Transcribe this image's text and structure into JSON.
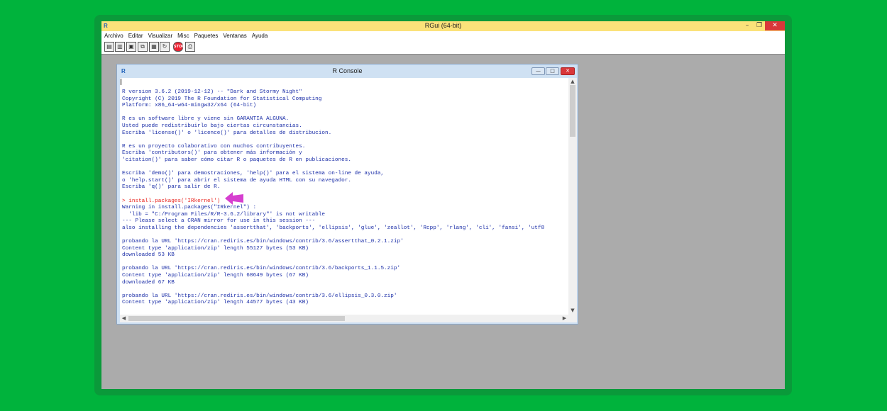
{
  "app": {
    "title": "RGui (64-bit)",
    "icon_label": "R"
  },
  "window_controls": {
    "minimize": "–",
    "maximize": "❐",
    "close": "✕"
  },
  "menu": [
    "Archivo",
    "Editar",
    "Visualizar",
    "Misc",
    "Paquetes",
    "Ventanas",
    "Ayuda"
  ],
  "toolbar": {
    "buttons": [
      "open-script-icon",
      "load-workspace-icon",
      "save-icon",
      "copy-icon",
      "paste-icon",
      "refresh-icon",
      "stop-icon",
      "print-icon"
    ],
    "stop_label": "STOP"
  },
  "console": {
    "title": "R Console",
    "icon_label": "R",
    "controls": {
      "minimize": "—",
      "maximize": "□",
      "close": "✕"
    },
    "lines": [
      "R version 3.6.2 (2019-12-12) -- \"Dark and Stormy Night\"",
      "Copyright (C) 2019 The R Foundation for Statistical Computing",
      "Platform: x86_64-w64-mingw32/x64 (64-bit)",
      "",
      "R es un software libre y viene sin GARANTIA ALGUNA.",
      "Usted puede redistribuirlo bajo ciertas circunstancias.",
      "Escriba 'license()' o 'licence()' para detalles de distribucion.",
      "",
      "R es un proyecto colaborativo con muchos contribuyentes.",
      "Escriba 'contributors()' para obtener más información y",
      "'citation()' para saber cómo citar R o paquetes de R en publicaciones.",
      "",
      "Escriba 'demo()' para demostraciones, 'help()' para el sistema on-line de ayuda,",
      "o 'help.start()' para abrir el sistema de ayuda HTML con su navegador.",
      "Escriba 'q()' para salir de R.",
      "",
      "> install.packages('IRkernel')",
      "Warning in install.packages(\"IRkernel\") :",
      "  'lib = \"C:/Program Files/R/R-3.6.2/library\"' is not writable",
      "--- Please select a CRAN mirror for use in this session ---",
      "also installing the dependencies 'assertthat', 'backports', 'ellipsis', 'glue', 'zeallot', 'Rcpp', 'rlang', 'cli', 'fansi', 'utf8",
      "",
      "probando la URL 'https://cran.rediris.es/bin/windows/contrib/3.6/assertthat_0.2.1.zip'",
      "Content type 'application/zip' length 55127 bytes (53 KB)",
      "downloaded 53 KB",
      "",
      "probando la URL 'https://cran.rediris.es/bin/windows/contrib/3.6/backports_1.1.5.zip'",
      "Content type 'application/zip' length 68649 bytes (67 KB)",
      "downloaded 67 KB",
      "",
      "probando la URL 'https://cran.rediris.es/bin/windows/contrib/3.6/ellipsis_0.3.0.zip'",
      "Content type 'application/zip' length 44577 bytes (43 KB)"
    ],
    "highlight_line_index": 16,
    "command_color": "#e8231d",
    "output_color": "#1c2fa8",
    "annotation_arrow_color": "#d63fcf"
  },
  "scrollbar": {
    "up": "▲",
    "down": "▼",
    "left": "◀",
    "right": "▶"
  }
}
